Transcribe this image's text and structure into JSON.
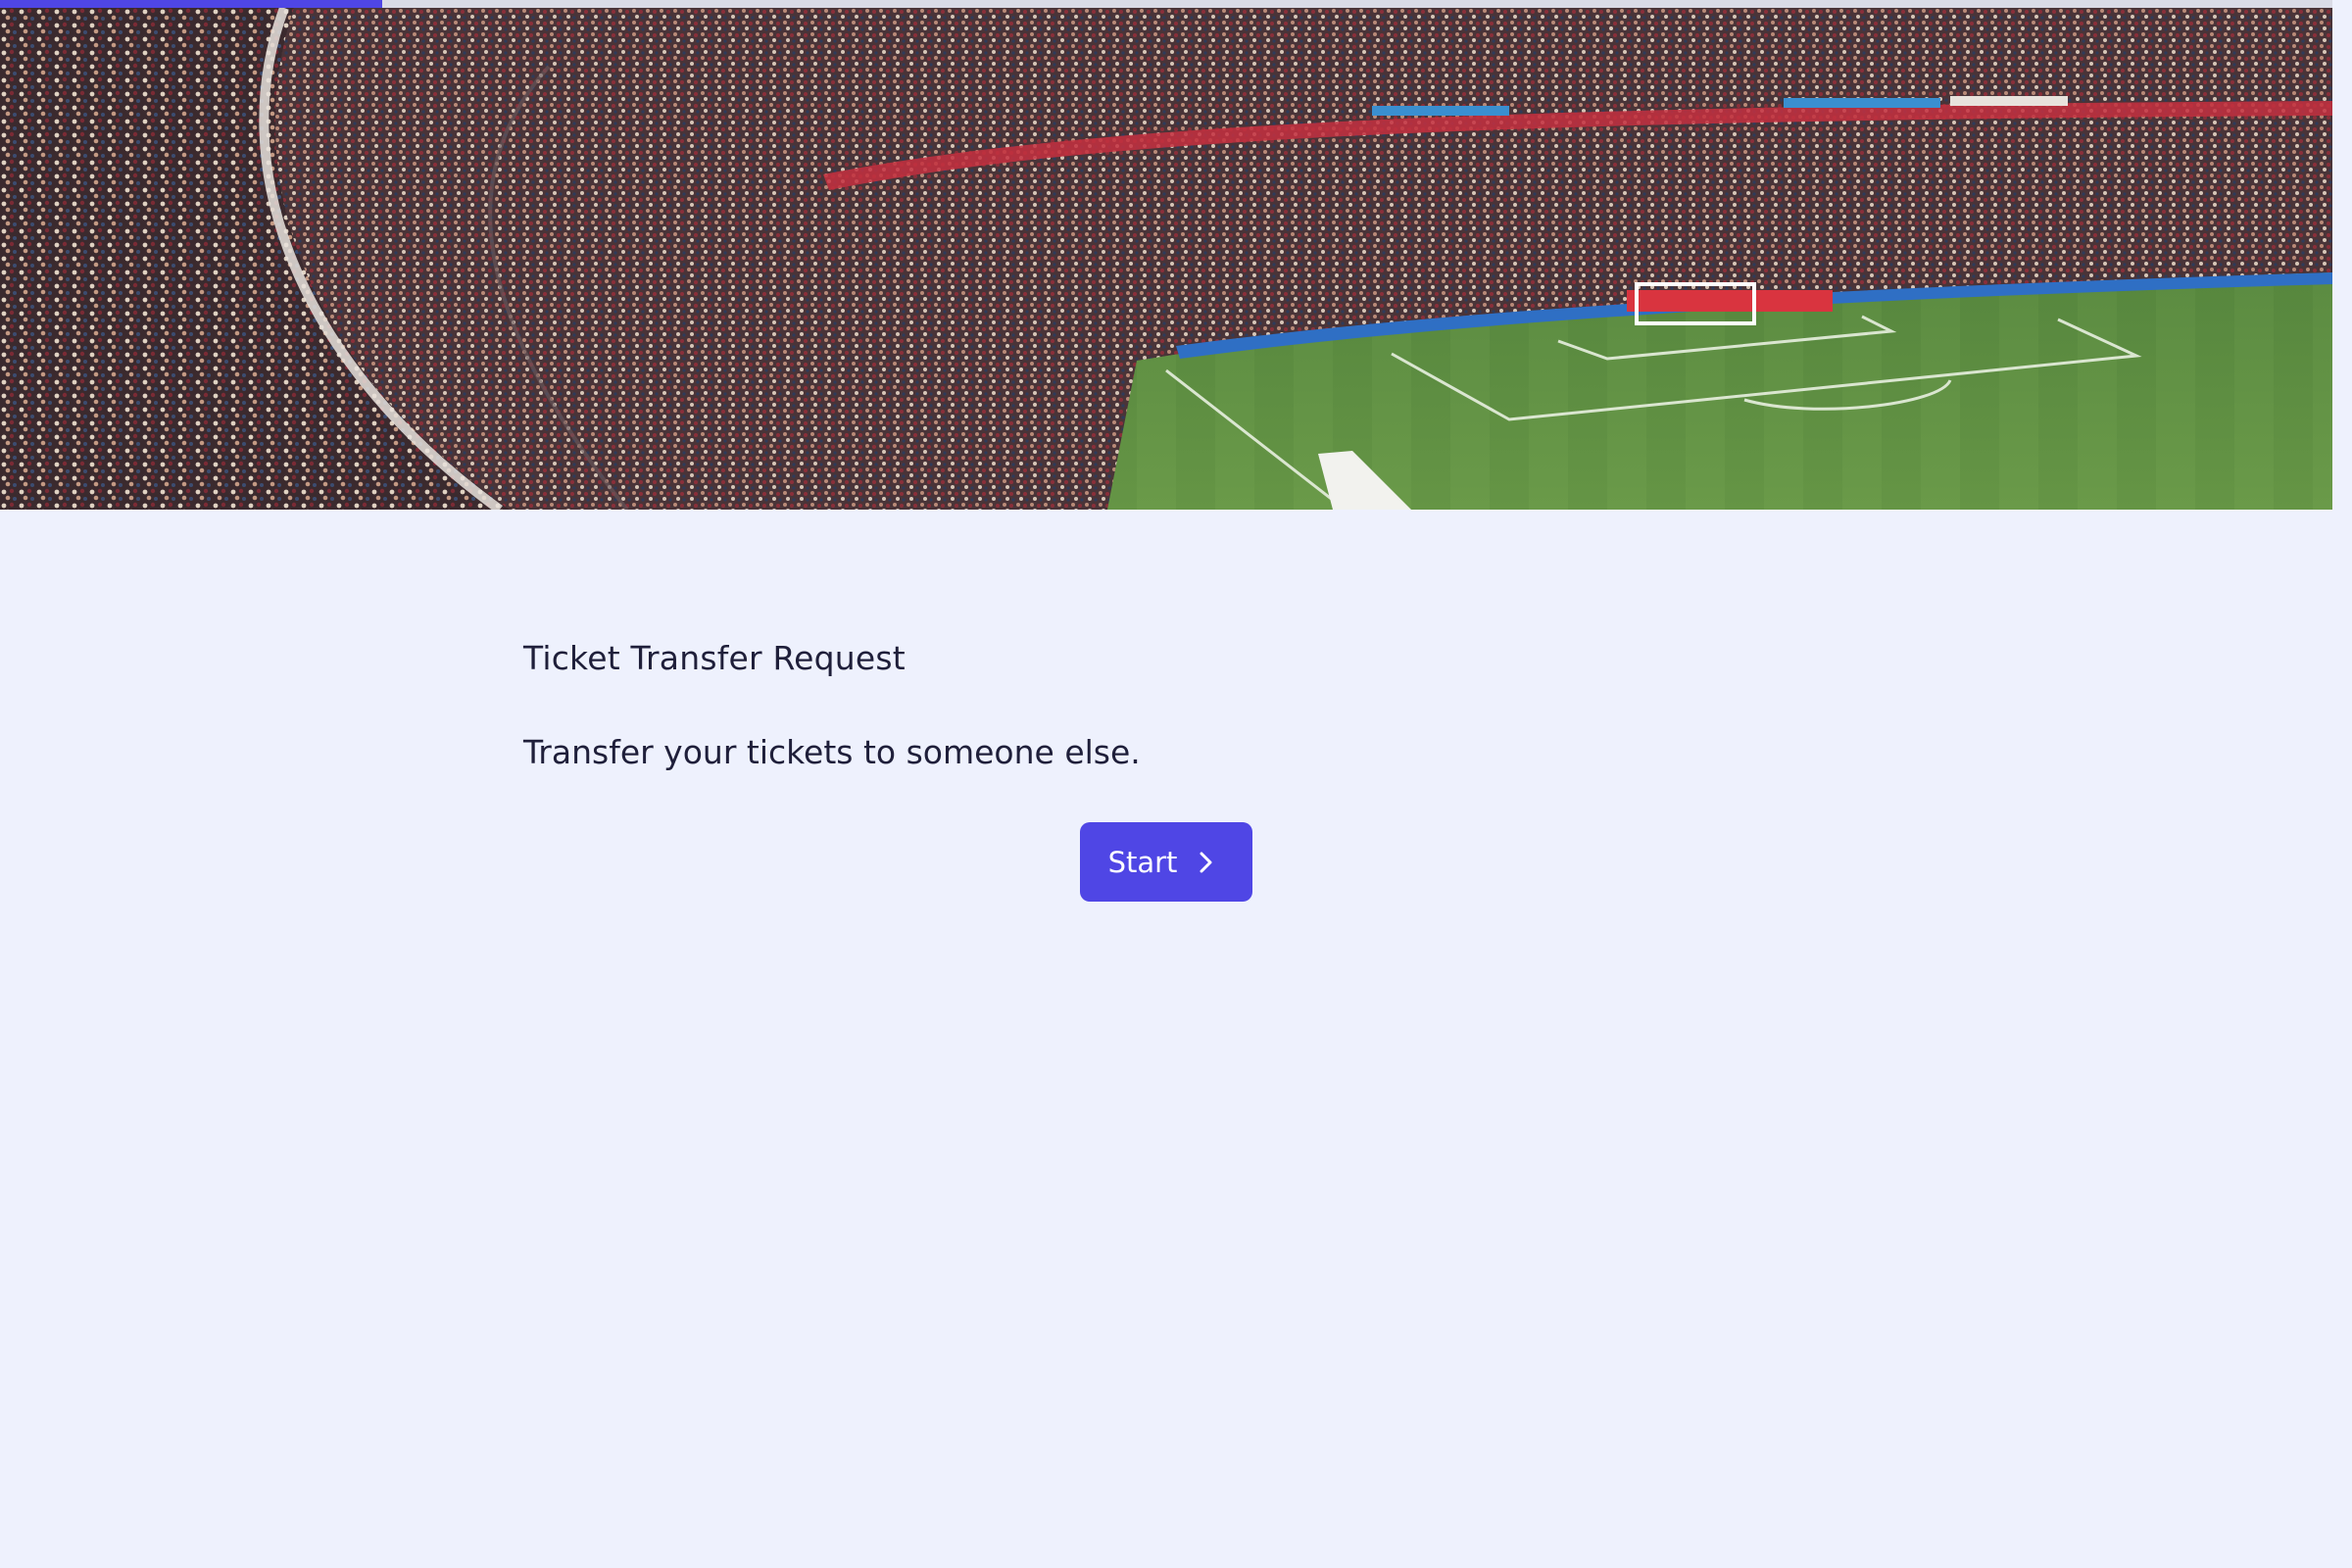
{
  "progress": {
    "fraction": 0.164
  },
  "hero": {
    "image_description": "stadium-crowd-and-football-pitch"
  },
  "form": {
    "title": "Ticket Transfer Request",
    "description": "Transfer your tickets to someone else."
  },
  "start_button": {
    "label": "Start",
    "icon": "chevron-right-icon"
  },
  "colors": {
    "accent": "#4f46e5",
    "background": "#eef1fd",
    "text": "#1f1f3a"
  }
}
